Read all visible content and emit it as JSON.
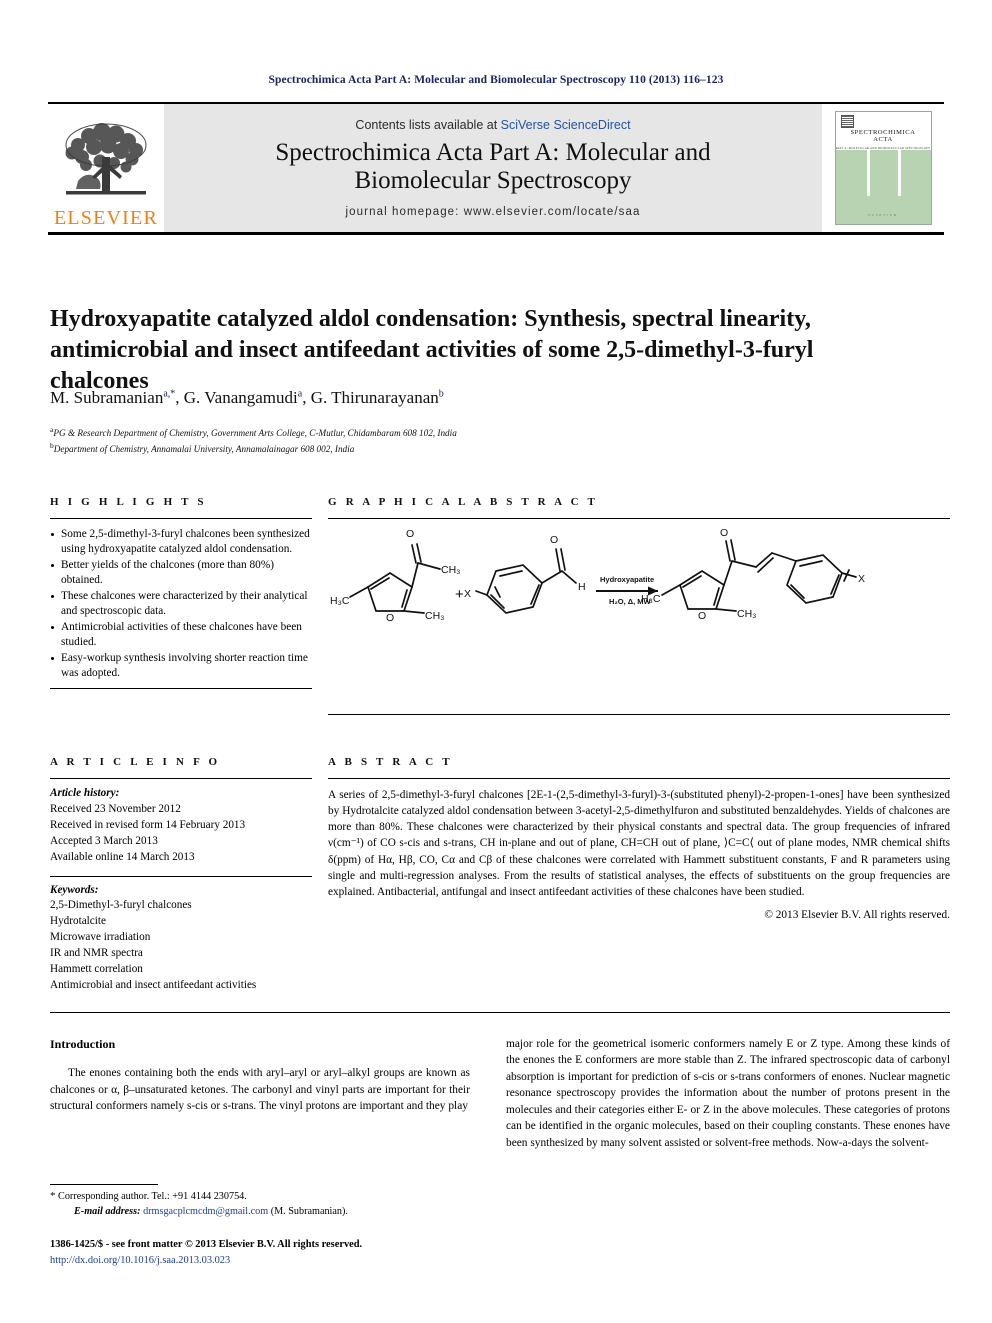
{
  "running_head": "Spectrochimica Acta Part A: Molecular and Biomolecular Spectroscopy 110 (2013) 116–123",
  "masthead": {
    "publisher_name": "ELSEVIER",
    "publisher_logo_icon": "elsevier-tree-icon",
    "contents_prefix": "Contents lists available at ",
    "contents_link": "SciVerse ScienceDirect",
    "journal_title": "Spectrochimica Acta Part A: Molecular and Biomolecular Spectroscopy",
    "homepage": "journal homepage: www.elsevier.com/locate/saa",
    "cover": {
      "title_line1": "SPECTROCHIMICA",
      "title_line2": "ACTA",
      "subtitle": "PART A: MOLECULAR AND BIOMOLECULAR SPECTROSCOPY",
      "footer": "ELSEVIER",
      "band_color": "#b7d3b2"
    }
  },
  "article": {
    "title": "Hydroxyapatite catalyzed aldol condensation: Synthesis, spectral linearity, antimicrobial and insect antifeedant activities of some 2,5-dimethyl-3-furyl chalcones",
    "authors": [
      {
        "name": "M. Subramanian",
        "marks": "a,*"
      },
      {
        "name": "G. Vanangamudi",
        "marks": "a"
      },
      {
        "name": "G. Thirunarayanan",
        "marks": "b"
      }
    ],
    "affiliations": [
      {
        "mark": "a",
        "text": "PG & Research Department of Chemistry, Government Arts College, C-Mutlur, Chidambaram 608 102, India"
      },
      {
        "mark": "b",
        "text": "Department of Chemistry, Annamalai University, Annamalainagar 608 002, India"
      }
    ]
  },
  "highlights": {
    "heading": "H I G H L I G H T S",
    "items": [
      "Some 2,5-dimethyl-3-furyl chalcones been synthesized using hydroxyapatite catalyzed aldol condensation.",
      "Better yields of the chalcones (more than 80%) obtained.",
      "These chalcones were characterized by their analytical and spectroscopic data.",
      "Antimicrobial activities of these chalcones have been studied.",
      "Easy-workup synthesis involving shorter reaction time was adopted."
    ]
  },
  "graphical_abstract": {
    "heading": "G R A P H I C A L   A B S T R A C T",
    "scheme": {
      "plus_sign": "+",
      "reagent_above": "Hydroxyapatite",
      "reagent_below": "H₂O, Δ, MW",
      "labels": {
        "oxygen": "O",
        "methyl": "CH₃",
        "methyl_left": "H₃C",
        "hydrogen": "H",
        "substituent": "X",
        "ring_oxygen": "O"
      }
    }
  },
  "article_info": {
    "heading": "A R T I C L E   I N F O",
    "history_label": "Article history:",
    "history": [
      "Received 23 November 2012",
      "Received in revised form 14 February 2013",
      "Accepted 3 March 2013",
      "Available online 14 March 2013"
    ],
    "keywords_label": "Keywords:",
    "keywords": [
      "2,5-Dimethyl-3-furyl chalcones",
      "Hydrotalcite",
      "Microwave irradiation",
      "IR and NMR spectra",
      "Hammett correlation",
      "Antimicrobial and insect antifeedant activities"
    ]
  },
  "abstract": {
    "heading": "A B S T R A C T",
    "text": "A series of 2,5-dimethyl-3-furyl chalcones [2E-1-(2,5-dimethyl-3-furyl)-3-(substituted phenyl)-2-propen-1-ones] have been synthesized by Hydrotalcite catalyzed aldol condensation between 3-acetyl-2,5-dimethylfuron and substituted benzaldehydes. Yields of chalcones are more than 80%. These chalcones were characterized by their physical constants and spectral data. The group frequencies of infrared ν(cm⁻¹) of CO s-cis and s-trans, CH in-plane and out of plane, CH=CH out of plane, ⟩C=C⟨ out of plane modes, NMR chemical shifts δ(ppm) of Hα, Hβ, CO, Cα and Cβ of these chalcones were correlated with Hammett substituent constants, F and R parameters using single and multi-regression analyses. From the results of statistical analyses, the effects of substituents on the group frequencies are explained. Antibacterial, antifungal and insect antifeedant activities of these chalcones have been studied.",
    "copyright": "© 2013 Elsevier B.V. All rights reserved."
  },
  "body": {
    "heading": "Introduction",
    "left_paragraph": "The enones containing both the ends with aryl–aryl or aryl–alkyl groups are known as chalcones or α, β–unsaturated ketones. The carbonyl and vinyl parts are important for their structural conformers namely s-cis or s-trans. The vinyl protons are important and they play",
    "right_paragraph": "major role for the geometrical isomeric conformers namely E or Z type. Among these kinds of the enones the E conformers are more stable than Z. The infrared spectroscopic data of carbonyl absorption is important for prediction of s-cis or s-trans conformers of enones. Nuclear magnetic resonance spectroscopy provides the information about the number of protons present in the molecules and their categories either E- or Z in the above molecules. These categories of protons can be identified in the organic molecules, based on their coupling constants. These enones have been synthesized by many solvent assisted or solvent-free methods. Now-a-days the solvent-"
  },
  "footnotes": {
    "star": "*",
    "corresponding": "Corresponding author. Tel.: +91 4144 230754.",
    "email_label": "E-mail address:",
    "email": "drmsgacplcmcdm@gmail.com",
    "email_owner": "(M. Subramanian).",
    "issn_line": "1386-1425/$ - see front matter © 2013 Elsevier B.V. All rights reserved.",
    "doi": "http://dx.doi.org/10.1016/j.saa.2013.03.023"
  },
  "colors": {
    "running_head": "#1a2560",
    "link": "#2552a0",
    "elsevier_orange": "#ec8013",
    "masthead_grey": "#e6e6e6"
  }
}
